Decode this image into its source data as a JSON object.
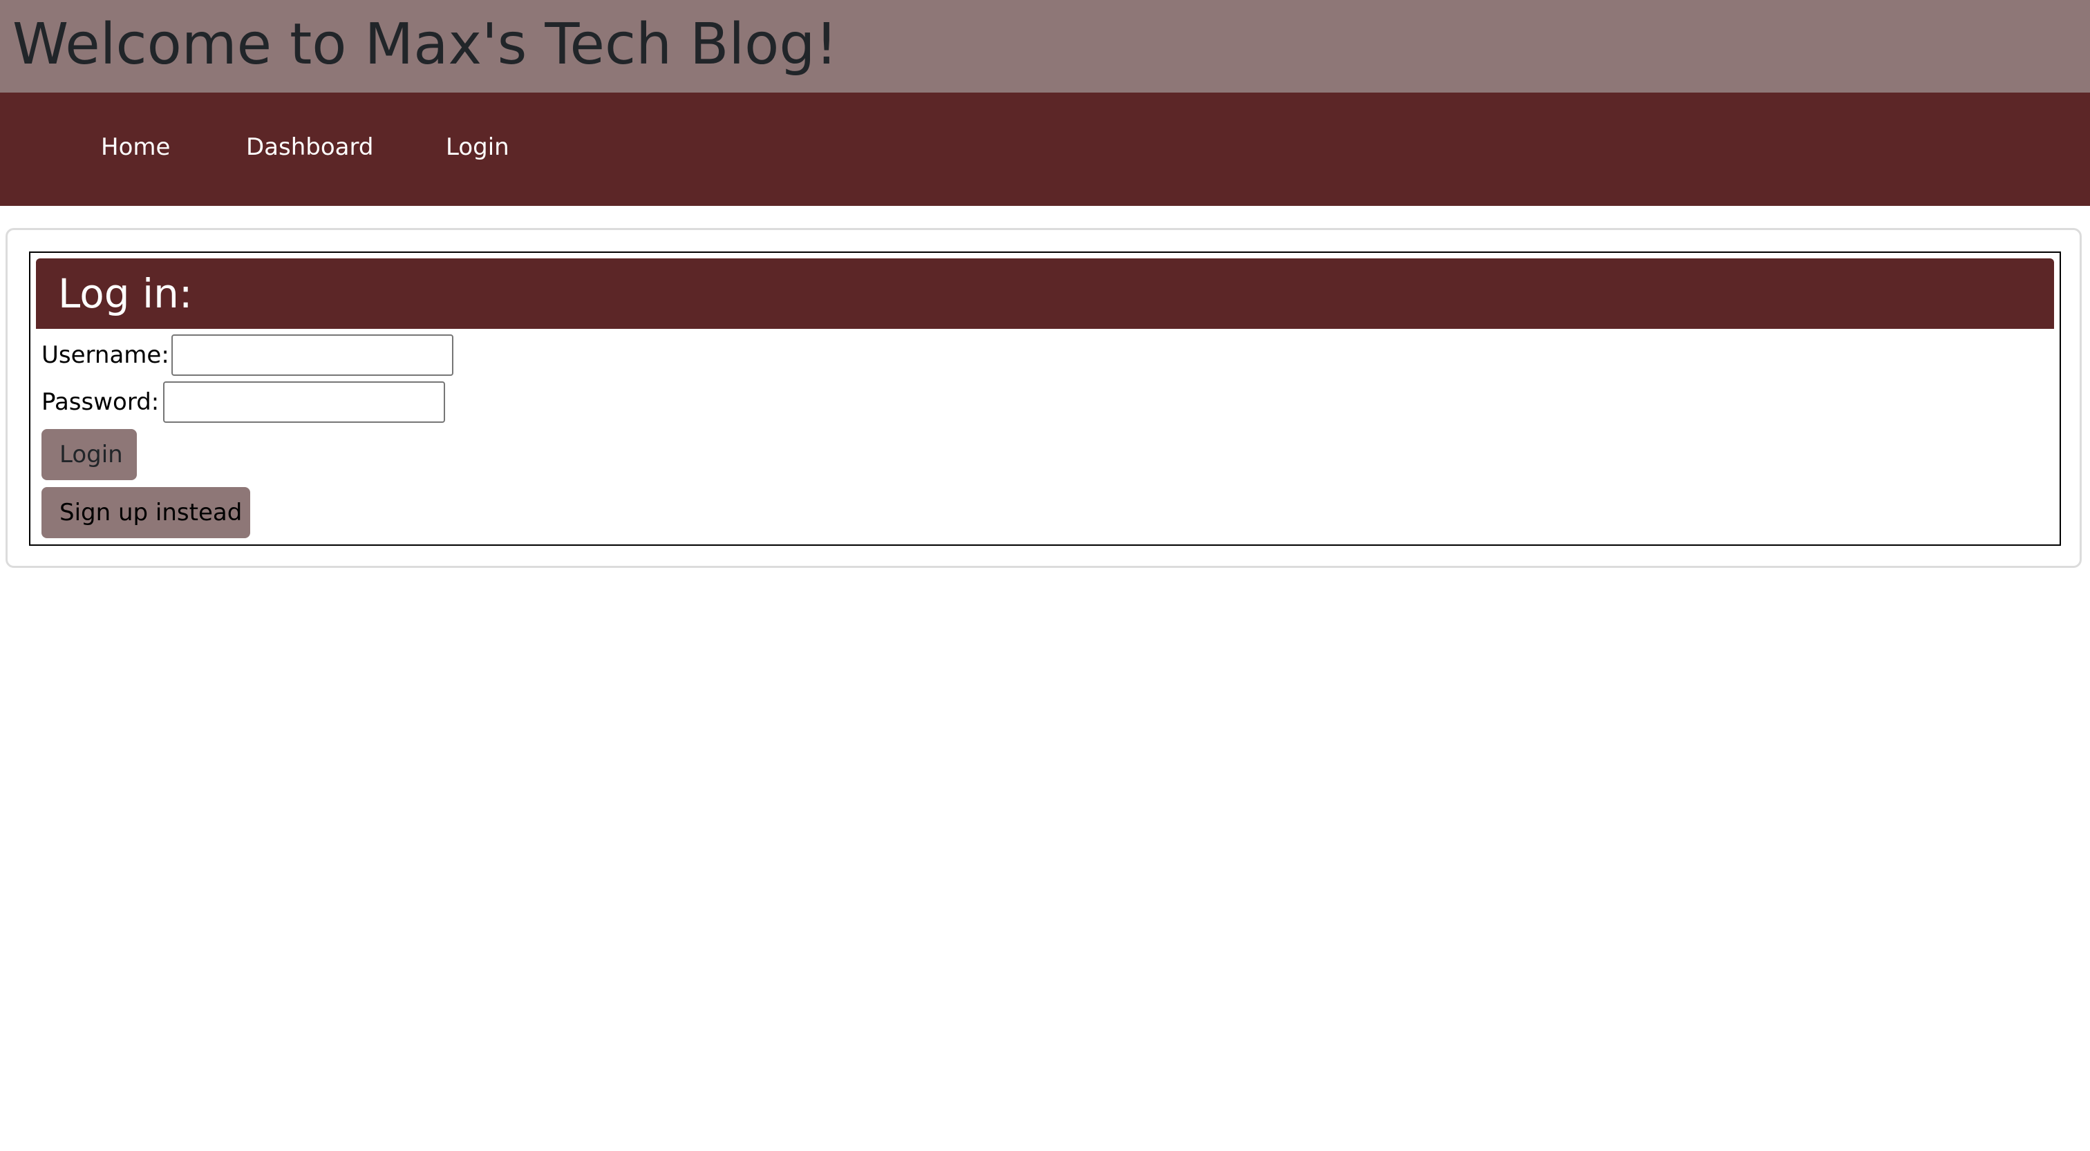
{
  "header": {
    "title": "Welcome to Max's Tech Blog!"
  },
  "nav": {
    "items": [
      {
        "label": "Home"
      },
      {
        "label": "Dashboard"
      },
      {
        "label": "Login"
      }
    ]
  },
  "login_form": {
    "title": "Log in:",
    "username_label": "Username:",
    "username_value": "",
    "password_label": "Password:",
    "password_value": "",
    "login_button": "Login",
    "signup_button": "Sign up instead"
  },
  "colors": {
    "header_bg": "#8e7777",
    "nav_bg": "#5c2627",
    "button_bg": "#8e7777",
    "nav_text": "#ffffff"
  }
}
